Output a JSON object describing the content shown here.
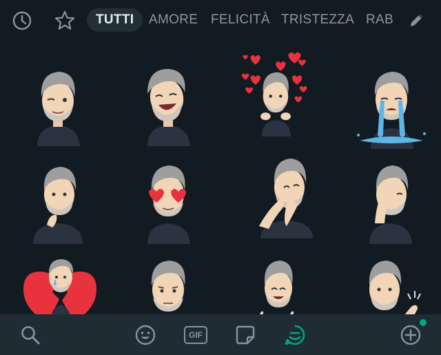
{
  "tabs": [
    {
      "label": "TUTTI",
      "active": true
    },
    {
      "label": "AMORE",
      "active": false
    },
    {
      "label": "FELICITÀ",
      "active": false
    },
    {
      "label": "TRISTEZZA",
      "active": false
    },
    {
      "label": "RAB",
      "active": false
    }
  ],
  "icons": {
    "recent": "clock-icon",
    "favorites": "star-icon",
    "edit": "pencil-icon",
    "search": "search-icon",
    "emoji": "smiley-icon",
    "gif_label": "GIF",
    "sticker": "sticker-icon",
    "avatar": "avatar-sticker-icon",
    "add": "plus-circle-icon"
  },
  "stickers": [
    "wink",
    "laugh",
    "hearts-around",
    "crying",
    "thinking",
    "heart-eyes",
    "facepalm-laugh",
    "facepalm",
    "broken-heart",
    "neutral",
    "thumbs-up",
    "waving"
  ],
  "colors": {
    "background": "#121b22",
    "bottom_bar": "#1f2c33",
    "accent": "#00a884",
    "active_tab_bg": "#222f37",
    "heart": "#e8333f"
  }
}
